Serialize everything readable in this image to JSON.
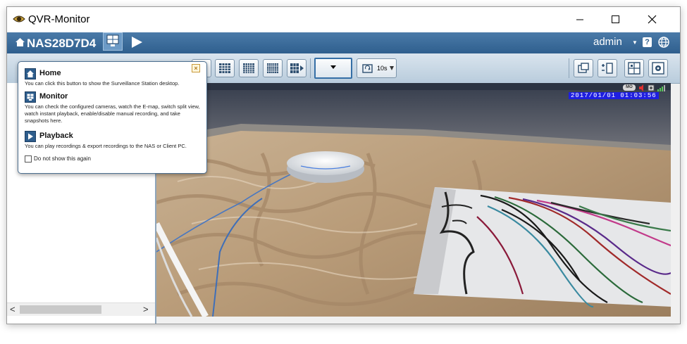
{
  "window": {
    "title": "QVR-Monitor"
  },
  "topbar": {
    "nas_name": "NAS28D7D4",
    "user": "admin",
    "help_label": "?"
  },
  "toolbar": {
    "sequence_interval": "10s"
  },
  "video": {
    "timestamp": "2017/01/01 01:03:56",
    "motion_badge": "MO"
  },
  "help_popup": {
    "close_label": "×",
    "sections": [
      {
        "title": "Home",
        "text": "You can click this button to show the Surveillance Station desktop."
      },
      {
        "title": "Monitor",
        "text": "You can check the configured cameras, watch the E-map, switch split view, watch instant playback, enable/disable manual recording, and take snapshots here."
      },
      {
        "title": "Playback",
        "text": "You can play recordings & export recordings to the NAS or Client PC."
      }
    ],
    "checkbox_label": "Do not show this again"
  },
  "sidebar": {
    "scroll_left": "<",
    "scroll_right": ">"
  },
  "colors": {
    "topbar": "#2f5f8e",
    "toolbar": "#c9d8e5",
    "osd_time_bg": "#1f1fe0",
    "popup_border": "#4d6f90"
  }
}
